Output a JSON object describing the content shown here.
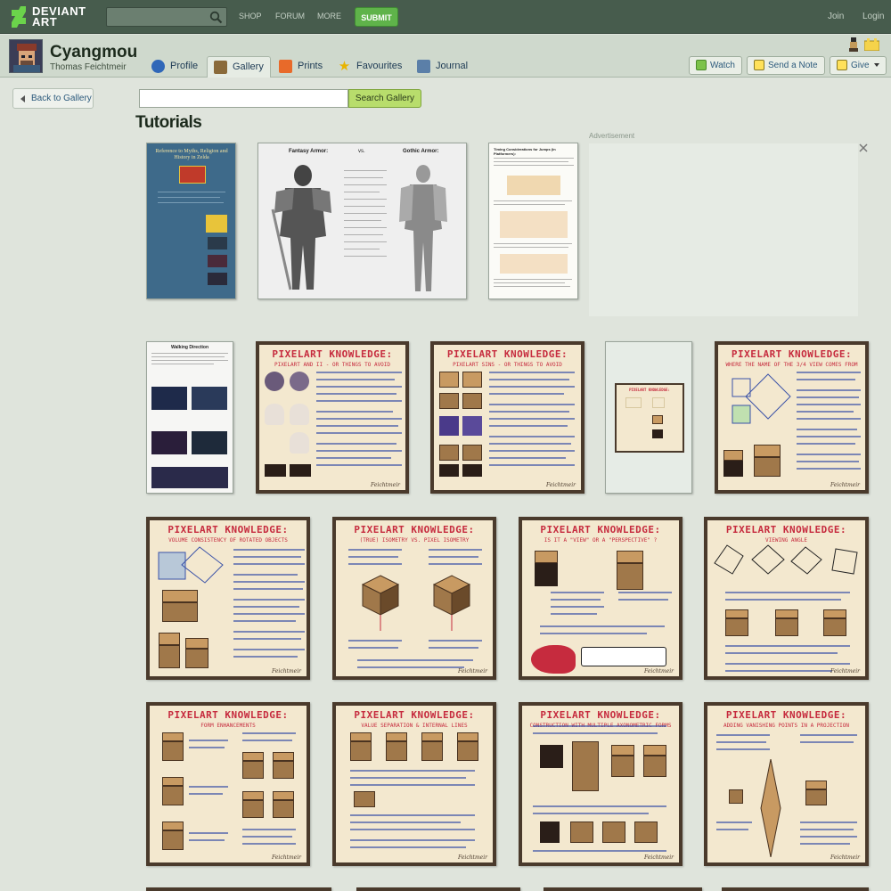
{
  "topbar": {
    "logo_line1": "DEVIANT",
    "logo_line2": "ART",
    "search_placeholder": "",
    "nav": [
      "SHOP",
      "FORUM",
      "MORE"
    ],
    "submit_label": "SUBMIT",
    "join_label": "Join",
    "login_label": "Login"
  },
  "profile": {
    "username": "Cyangmou",
    "realname": "Thomas Feichtmeir",
    "tabs": [
      {
        "label": "Profile",
        "icon": "info-icon",
        "active": false
      },
      {
        "label": "Gallery",
        "icon": "gallery-icon",
        "active": true
      },
      {
        "label": "Prints",
        "icon": "prints-icon",
        "active": false
      },
      {
        "label": "Favourites",
        "icon": "star-icon",
        "active": false
      },
      {
        "label": "Journal",
        "icon": "journal-icon",
        "active": false
      }
    ],
    "watch_label": "Watch",
    "note_label": "Send a Note",
    "give_label": "Give"
  },
  "gallery": {
    "back_label": "Back to Gallery",
    "search_value": "",
    "search_button": "Search Gallery",
    "folder_title": "Tutorials",
    "ad_label": "Advertisement"
  },
  "thumbs": {
    "pk_title": "PIXELART KNOWLEDGE:",
    "signature": "Feichtmeir",
    "subtitles": {
      "t5": "PIXELART AND II - OR THINGS TO AVOID",
      "t6": "PIXELART SINS - OR THINGS TO AVOID",
      "t8": "WHERE THE NAME OF THE 3/4 VIEW COMES FROM",
      "t9": "VOLUME CONSISTENCY OF ROTATED OBJECTS",
      "t10": "(TRUE) ISOMETRY  VS.  PIXEL ISOMETRY",
      "t11": "IS IT A \"VIEW\" OR A \"PERSPECTIVE\" ?",
      "t12": "VIEWING ANGLE",
      "t13": "FORM ENHANCEMENTS",
      "t14": "VALUE SEPARATION & INTERNAL LINES",
      "t15": "CONSTRUCTION WITH MULTIPLE AXONOMETRIC FORMS",
      "t16": "ADDING VANISHING POINTS IN A PROJECTION"
    },
    "doc_titles": {
      "t1": "Reference to Myths, Religion and History in Zelda",
      "t2_left": "Fantasy Armor:",
      "t2_mid": "vs.",
      "t2_right": "Gothic Armor:",
      "t3": "Timing Considerations for Jumps (in Platformers):",
      "t4": "Walking Direction"
    }
  },
  "colors": {
    "topbar": "#475c4d",
    "accent_green": "#5fb34a",
    "pixel_red": "#c62b3e",
    "pixel_blue": "#3a52a8"
  }
}
